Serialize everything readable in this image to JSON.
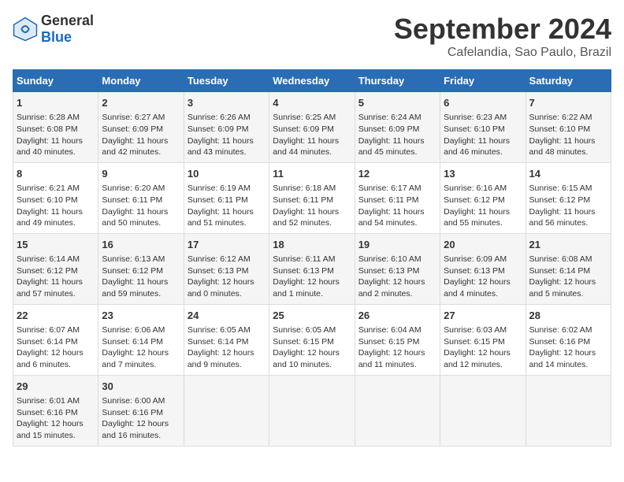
{
  "header": {
    "logo_general": "General",
    "logo_blue": "Blue",
    "main_title": "September 2024",
    "subtitle": "Cafelandia, Sao Paulo, Brazil"
  },
  "days_of_week": [
    "Sunday",
    "Monday",
    "Tuesday",
    "Wednesday",
    "Thursday",
    "Friday",
    "Saturday"
  ],
  "weeks": [
    [
      {
        "day": "1",
        "sunrise": "6:28 AM",
        "sunset": "6:08 PM",
        "daylight": "11 hours and 40 minutes."
      },
      {
        "day": "2",
        "sunrise": "6:27 AM",
        "sunset": "6:09 PM",
        "daylight": "11 hours and 42 minutes."
      },
      {
        "day": "3",
        "sunrise": "6:26 AM",
        "sunset": "6:09 PM",
        "daylight": "11 hours and 43 minutes."
      },
      {
        "day": "4",
        "sunrise": "6:25 AM",
        "sunset": "6:09 PM",
        "daylight": "11 hours and 44 minutes."
      },
      {
        "day": "5",
        "sunrise": "6:24 AM",
        "sunset": "6:09 PM",
        "daylight": "11 hours and 45 minutes."
      },
      {
        "day": "6",
        "sunrise": "6:23 AM",
        "sunset": "6:10 PM",
        "daylight": "11 hours and 46 minutes."
      },
      {
        "day": "7",
        "sunrise": "6:22 AM",
        "sunset": "6:10 PM",
        "daylight": "11 hours and 48 minutes."
      }
    ],
    [
      {
        "day": "8",
        "sunrise": "6:21 AM",
        "sunset": "6:10 PM",
        "daylight": "11 hours and 49 minutes."
      },
      {
        "day": "9",
        "sunrise": "6:20 AM",
        "sunset": "6:11 PM",
        "daylight": "11 hours and 50 minutes."
      },
      {
        "day": "10",
        "sunrise": "6:19 AM",
        "sunset": "6:11 PM",
        "daylight": "11 hours and 51 minutes."
      },
      {
        "day": "11",
        "sunrise": "6:18 AM",
        "sunset": "6:11 PM",
        "daylight": "11 hours and 52 minutes."
      },
      {
        "day": "12",
        "sunrise": "6:17 AM",
        "sunset": "6:11 PM",
        "daylight": "11 hours and 54 minutes."
      },
      {
        "day": "13",
        "sunrise": "6:16 AM",
        "sunset": "6:12 PM",
        "daylight": "11 hours and 55 minutes."
      },
      {
        "day": "14",
        "sunrise": "6:15 AM",
        "sunset": "6:12 PM",
        "daylight": "11 hours and 56 minutes."
      }
    ],
    [
      {
        "day": "15",
        "sunrise": "6:14 AM",
        "sunset": "6:12 PM",
        "daylight": "11 hours and 57 minutes."
      },
      {
        "day": "16",
        "sunrise": "6:13 AM",
        "sunset": "6:12 PM",
        "daylight": "11 hours and 59 minutes."
      },
      {
        "day": "17",
        "sunrise": "6:12 AM",
        "sunset": "6:13 PM",
        "daylight": "12 hours and 0 minutes."
      },
      {
        "day": "18",
        "sunrise": "6:11 AM",
        "sunset": "6:13 PM",
        "daylight": "12 hours and 1 minute."
      },
      {
        "day": "19",
        "sunrise": "6:10 AM",
        "sunset": "6:13 PM",
        "daylight": "12 hours and 2 minutes."
      },
      {
        "day": "20",
        "sunrise": "6:09 AM",
        "sunset": "6:13 PM",
        "daylight": "12 hours and 4 minutes."
      },
      {
        "day": "21",
        "sunrise": "6:08 AM",
        "sunset": "6:14 PM",
        "daylight": "12 hours and 5 minutes."
      }
    ],
    [
      {
        "day": "22",
        "sunrise": "6:07 AM",
        "sunset": "6:14 PM",
        "daylight": "12 hours and 6 minutes."
      },
      {
        "day": "23",
        "sunrise": "6:06 AM",
        "sunset": "6:14 PM",
        "daylight": "12 hours and 7 minutes."
      },
      {
        "day": "24",
        "sunrise": "6:05 AM",
        "sunset": "6:14 PM",
        "daylight": "12 hours and 9 minutes."
      },
      {
        "day": "25",
        "sunrise": "6:05 AM",
        "sunset": "6:15 PM",
        "daylight": "12 hours and 10 minutes."
      },
      {
        "day": "26",
        "sunrise": "6:04 AM",
        "sunset": "6:15 PM",
        "daylight": "12 hours and 11 minutes."
      },
      {
        "day": "27",
        "sunrise": "6:03 AM",
        "sunset": "6:15 PM",
        "daylight": "12 hours and 12 minutes."
      },
      {
        "day": "28",
        "sunrise": "6:02 AM",
        "sunset": "6:16 PM",
        "daylight": "12 hours and 14 minutes."
      }
    ],
    [
      {
        "day": "29",
        "sunrise": "6:01 AM",
        "sunset": "6:16 PM",
        "daylight": "12 hours and 15 minutes."
      },
      {
        "day": "30",
        "sunrise": "6:00 AM",
        "sunset": "6:16 PM",
        "daylight": "12 hours and 16 minutes."
      },
      null,
      null,
      null,
      null,
      null
    ]
  ]
}
